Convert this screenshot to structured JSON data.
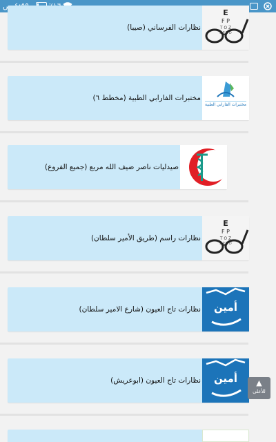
{
  "status_bar": {
    "time": "٤:٥٩ ص",
    "battery": "٪١٦",
    "battery_fraction": 0.16,
    "icons": [
      "wifi-icon",
      "battery-icon",
      "screenshot-icon",
      "notification-icon"
    ]
  },
  "colors": {
    "status_bar": "#4a96c8",
    "card_bg": "#cbe9f9",
    "page_bg": "#f2f2f2",
    "blue_logo": "#1c74b9",
    "scroll_button": "#7a8088"
  },
  "listings": [
    {
      "title": "نظارات الفرساني (صيبا)",
      "thumbnail": "eye-chart-glasses-icon"
    },
    {
      "title": "مختبرات الفارابي الطبية (مخطط ٦)",
      "thumbnail": "farabi-lab-logo",
      "logo_text": "مختبرات الفارابي الطبية"
    },
    {
      "title": "صيدليات ناصر ضيف الله مربع (جميع الفروع)",
      "thumbnail": "red-crescent-pharmacy-logo"
    },
    {
      "title": "نظارات راسم (طريق الأمير سلطان)",
      "thumbnail": "eye-chart-glasses-icon"
    },
    {
      "title": "نظارات تاج العيون (شارع الامير سلطان)",
      "thumbnail": "taj-eyes-logo",
      "logo_text": "أمين"
    },
    {
      "title": "نظارات تاج العيون (ابوعريش)",
      "thumbnail": "taj-eyes-logo",
      "logo_text": "أمين"
    }
  ],
  "scroll_top_button": {
    "label": "للأعلى"
  }
}
